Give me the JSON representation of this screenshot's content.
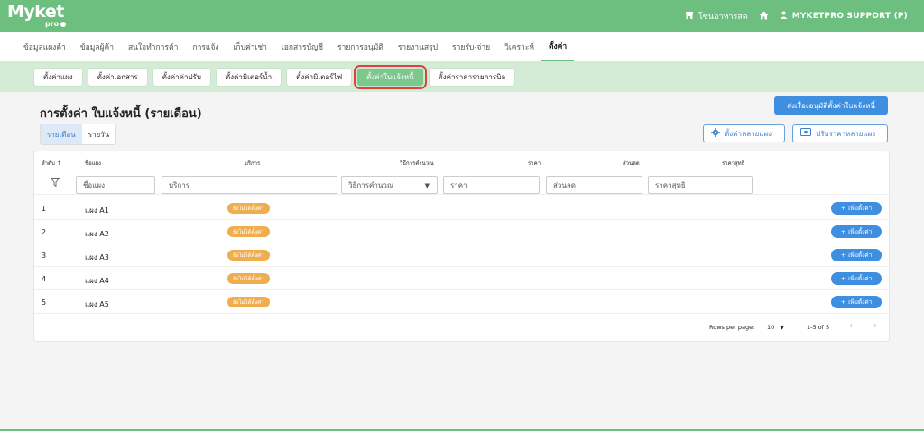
{
  "app": {
    "logo": "Myket",
    "logo_sub": "pro",
    "branch": "โซนอาหารสด",
    "user": "MYKETPRO SUPPORT (P)",
    "brand_color": "#6cbf7e"
  },
  "main_nav": [
    {
      "label": "ข้อมูลแผงค้า",
      "active": false
    },
    {
      "label": "ข้อมูลผู้ค้า",
      "active": false
    },
    {
      "label": "สนใจทำการค้า",
      "active": false
    },
    {
      "label": "การแจ้ง",
      "active": false
    },
    {
      "label": "เก็บค่าเช่า",
      "active": false
    },
    {
      "label": "เอกสารบัญชี",
      "active": false
    },
    {
      "label": "รายการอนุมัติ",
      "active": false
    },
    {
      "label": "รายงานสรุป",
      "active": false
    },
    {
      "label": "รายรับ-จ่าย",
      "active": false
    },
    {
      "label": "วิเคราะห์",
      "active": false
    },
    {
      "label": "ตั้งค่า",
      "active": true
    }
  ],
  "sub_nav": [
    {
      "label": "ตั้งค่าแผง",
      "active": false
    },
    {
      "label": "ตั้งค่าเอกสาร",
      "active": false
    },
    {
      "label": "ตั้งค่าค่าปรับ",
      "active": false
    },
    {
      "label": "ตั้งค่ามิเตอร์น้ำ",
      "active": false
    },
    {
      "label": "ตั้งค่ามิเตอร์ไฟ",
      "active": false
    },
    {
      "label": "ตั้งค่าใบแจ้งหนี้",
      "active": true
    },
    {
      "label": "ตั้งค่าราคารายการบิล",
      "active": false
    }
  ],
  "page": {
    "title": "การตั้งค่า ใบแจ้งหนี้ (รายเดือน)",
    "submit_approval": "ส่งเรื่องอนุมัติตั้งค่าใบแจ้งหนี้",
    "toggle": {
      "monthly": "รายเดือน",
      "daily": "รายวัน"
    },
    "bulk_settings": "ตั้งค่าหลายแผง",
    "bulk_price": "ปรับราคาหลายแผง"
  },
  "table": {
    "headers": {
      "order": "ลำดับ",
      "name": "ชื่อแผง",
      "service": "บริการ",
      "method": "วิธีการคำนวณ",
      "price": "ราคา",
      "discount": "ส่วนลด",
      "net": "ราคาสุทธิ"
    },
    "filters": {
      "name": "ชื่อแผง",
      "service": "บริการ",
      "method": "วิธีการคำนวณ",
      "price": "ราคา",
      "discount": "ส่วนลด",
      "net": "ราคาสุทธิ"
    },
    "rows": [
      {
        "no": "1",
        "name": "แผง A1",
        "status": "ยังไม่ได้ตั้งค่า",
        "action": "เพิ่มตั้งค่า"
      },
      {
        "no": "2",
        "name": "แผง A2",
        "status": "ยังไม่ได้ตั้งค่า",
        "action": "เพิ่มตั้งค่า"
      },
      {
        "no": "3",
        "name": "แผง A3",
        "status": "ยังไม่ได้ตั้งค่า",
        "action": "เพิ่มตั้งค่า"
      },
      {
        "no": "4",
        "name": "แผง A4",
        "status": "ยังไม่ได้ตั้งค่า",
        "action": "เพิ่มตั้งค่า"
      },
      {
        "no": "5",
        "name": "แผง A5",
        "status": "ยังไม่ได้ตั้งค่า",
        "action": "เพิ่มตั้งค่า"
      }
    ],
    "pagination": {
      "rows_per_page_label": "Rows per page:",
      "rows_per_page": "10",
      "range": "1-5 of 5"
    }
  },
  "icons": {
    "store": "store-icon",
    "home": "home-icon",
    "user": "user-icon",
    "gear": "gear-icon",
    "price": "price-adjust-icon",
    "filter": "filter-icon",
    "plus": "plus-icon"
  }
}
